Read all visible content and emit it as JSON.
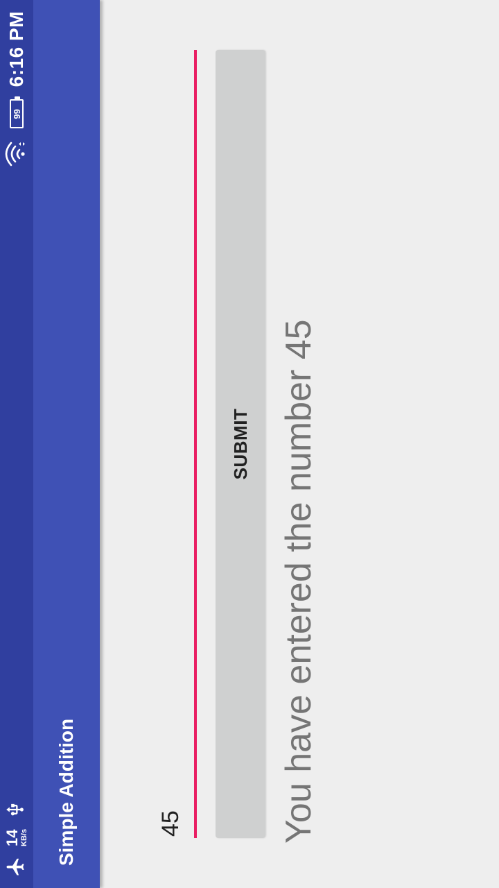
{
  "status_bar": {
    "network_speed_value": "14",
    "network_speed_unit": "KB/s",
    "battery_level": "99",
    "time": "6:16 PM",
    "icons": [
      "airplane-icon",
      "usb-icon",
      "wifi-icon",
      "battery-icon"
    ]
  },
  "app_bar": {
    "title": "Simple Addition",
    "color": "#3f51b5",
    "status_color": "#303f9f"
  },
  "form": {
    "input_value": "45",
    "accent_color": "#e91e63",
    "submit_label": "SUBMIT"
  },
  "result": {
    "message": "You have entered the number 45"
  }
}
